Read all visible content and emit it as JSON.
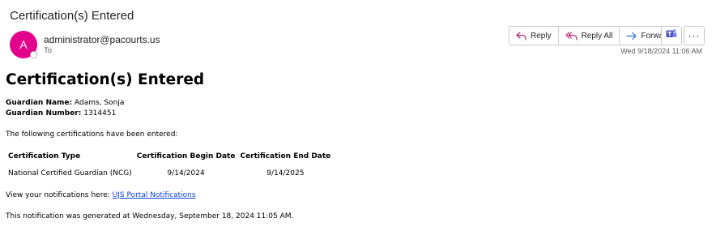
{
  "header": {
    "subject": "Certification(s) Entered",
    "avatar_initial": "A",
    "sender": "administrator@pacourts.us",
    "to_label": "To",
    "timestamp": "Wed 9/18/2024 11:06 AM"
  },
  "actions": {
    "reply": "Reply",
    "reply_all": "Reply All",
    "forward": "Forward",
    "teams_icon": "teams-icon",
    "more_label": "···"
  },
  "body": {
    "heading": "Certification(s) Entered",
    "guardian_name_label": "Guardian Name:",
    "guardian_name": "Adams, Sonja",
    "guardian_number_label": "Guardian Number:",
    "guardian_number": "1314451",
    "intro": "The following certifications have been entered:",
    "table": {
      "headers": [
        "Certification Type",
        "Certification Begin Date",
        "Certification End Date"
      ],
      "rows": [
        [
          "National Certified Guardian (NCG)",
          "9/14/2024",
          "9/14/2025"
        ]
      ]
    },
    "notifications_prefix": "View your notifications here:",
    "notifications_link": "UJS Portal Notifications",
    "generated": "This notification was generated at Wednesday, September 18, 2024 11:05 AM."
  },
  "colors": {
    "avatar": "#e3008c",
    "reply_icon": "#b4256c",
    "forward_icon": "#2f6fcf",
    "teams_icon": "#4b53bc",
    "link": "#0b3fd8"
  }
}
